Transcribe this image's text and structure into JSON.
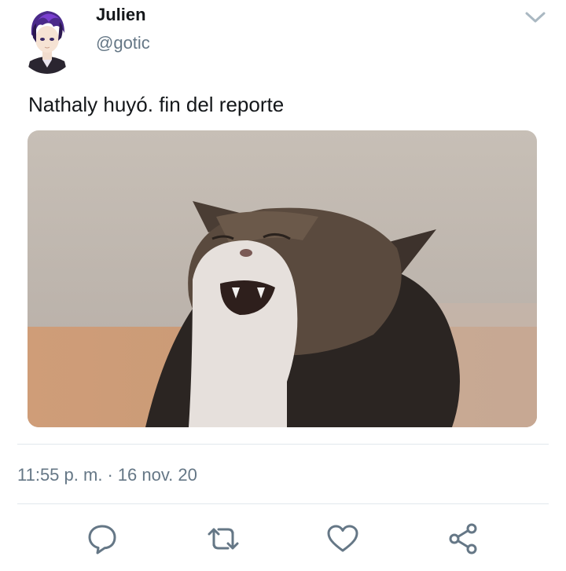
{
  "tweet": {
    "author_name": "Julien",
    "author_handle": "@gotic",
    "text": "Nathaly huyó. fin del reporte",
    "time": "11:55 p. m.",
    "separator": "·",
    "date": "16 nov. 20"
  },
  "icons": {
    "more": "chevron-down-icon",
    "reply": "reply-icon",
    "retweet": "retweet-icon",
    "like": "heart-icon",
    "share": "share-icon"
  },
  "colors": {
    "text": "#14171a",
    "secondary": "#657786",
    "icon": "#657786",
    "divider": "#e1e8ed"
  }
}
